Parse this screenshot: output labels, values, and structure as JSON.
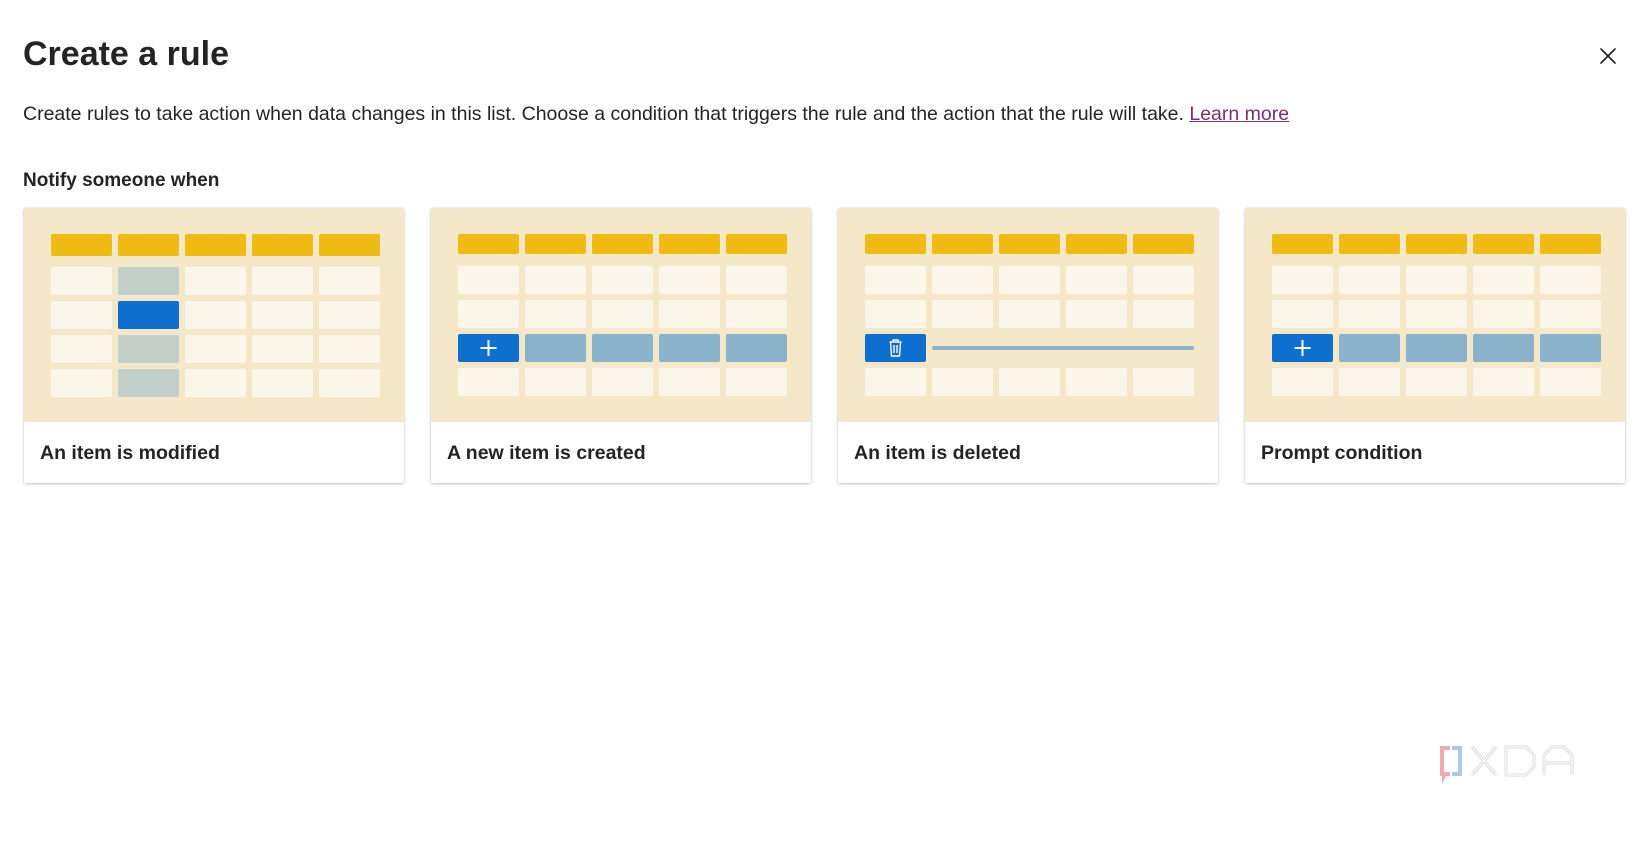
{
  "dialog": {
    "title": "Create a rule",
    "description": "Create rules to take action when data changes in this list. Choose a condition that triggers the rule and the action that the rule will take.",
    "learn_more": "Learn more",
    "section_label": "Notify someone when",
    "close_icon": "close-icon"
  },
  "cards": [
    {
      "label": "An item is modified",
      "illustration": "modified-table-illustration"
    },
    {
      "label": "A new item is created",
      "illustration": "created-table-illustration"
    },
    {
      "label": "An item is deleted",
      "illustration": "deleted-table-illustration"
    },
    {
      "label": "Prompt condition",
      "illustration": "prompt-table-illustration"
    }
  ],
  "watermark": {
    "text": "XDA"
  },
  "colors": {
    "header_cell": "#f0bb12",
    "cell": "#fbf6ea",
    "illustration_bg": "#f5e8c8",
    "accent_blue": "#0f6fd1",
    "light_blue": "#8ab3cb",
    "gray_green": "#c3cfc9",
    "link": "#7a2f6e"
  }
}
